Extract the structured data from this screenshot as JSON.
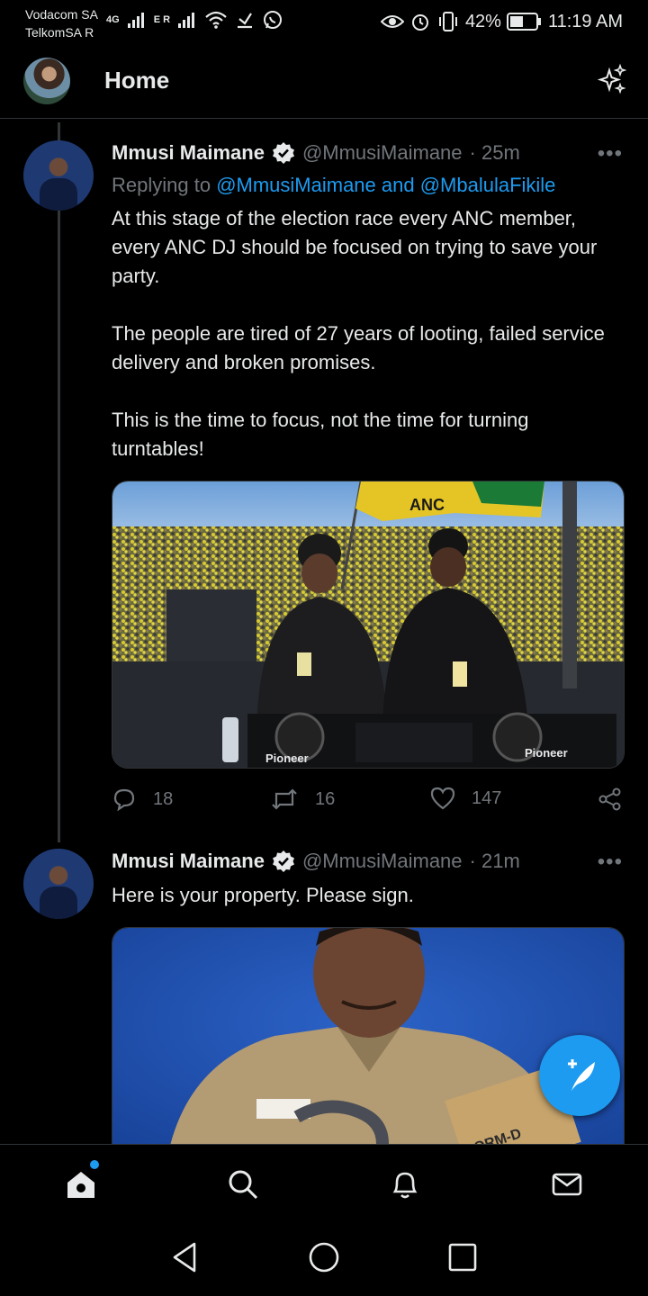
{
  "status_bar": {
    "carrier_1": "Vodacom SA",
    "carrier_2": "TelkomSA R",
    "network_1": "4G",
    "network_2": "E R",
    "battery": "42%",
    "time": "11:19 AM"
  },
  "header": {
    "title": "Home"
  },
  "tweets": [
    {
      "name": "Mmusi Maimane",
      "handle": "@MmusiMaimane",
      "time": "· 25m",
      "reply_prefix": "Replying to ",
      "reply_users": "@MmusiMaimane and @MbalulaFikile",
      "paragraphs": [
        "At this stage of the election race every ANC member, every ANC DJ should be focused on trying to save your party.",
        "The people are tired of 27 years of looting, failed service delivery and broken promises.",
        "This is the time to focus, not the time for turning turntables!"
      ],
      "image": {
        "flag_text": "ANC",
        "deck_brand_1": "Pioneer",
        "deck_brand_2": "Pioneer"
      },
      "replies": "18",
      "retweets": "16",
      "likes": "147"
    },
    {
      "name": "Mmusi Maimane",
      "handle": "@MmusiMaimane",
      "time": "· 21m",
      "text": "Here is your property. Please sign.",
      "image": {
        "box_text": "ORM-D"
      }
    }
  ],
  "colors": {
    "accent": "#1d9bf0",
    "background": "#000000",
    "text": "#e7e9ea",
    "muted": "#71767b"
  }
}
